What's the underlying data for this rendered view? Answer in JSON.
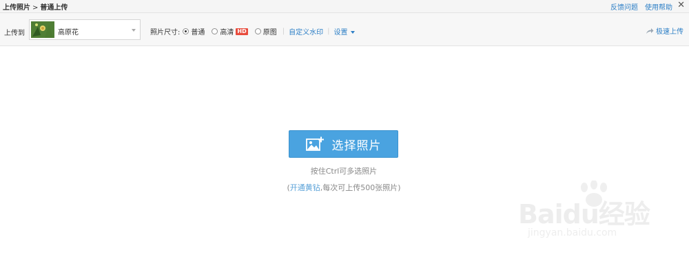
{
  "titlebar": {
    "breadcrumb_root": "上传照片",
    "breadcrumb_sep": ">",
    "breadcrumb_current": "普通上传",
    "feedback": "反馈问题",
    "help": "使用帮助",
    "close_symbol": "✕"
  },
  "toolbar": {
    "upload_to_label": "上传到",
    "album": {
      "name": "高原花",
      "thumb_icon": "flower-thumbnail"
    },
    "size_label": "照片尺寸:",
    "size_options": [
      {
        "label": "普通",
        "selected": true
      },
      {
        "label": "高清",
        "badge": "HD",
        "selected": false
      },
      {
        "label": "原图",
        "selected": false
      }
    ],
    "custom_watermark": "自定义水印",
    "settings": "设置",
    "fast_upload": "极速上传",
    "fast_upload_icon": "share-arrow-icon"
  },
  "main": {
    "select_button": "选择照片",
    "select_icon": "add-photo-icon",
    "hint_multi": "按住Ctrl可多选照片",
    "hint_prefix": "(",
    "hint_link": "开通黄钻",
    "hint_rest": ",每次可上传500张照片)"
  },
  "watermark": {
    "brand": "Baidu经验",
    "url": "jingyan.baidu.com"
  },
  "colors": {
    "button_bg": "#4aa3e0",
    "link": "#2d7fc6",
    "hd_badge": "#e84c3d"
  }
}
